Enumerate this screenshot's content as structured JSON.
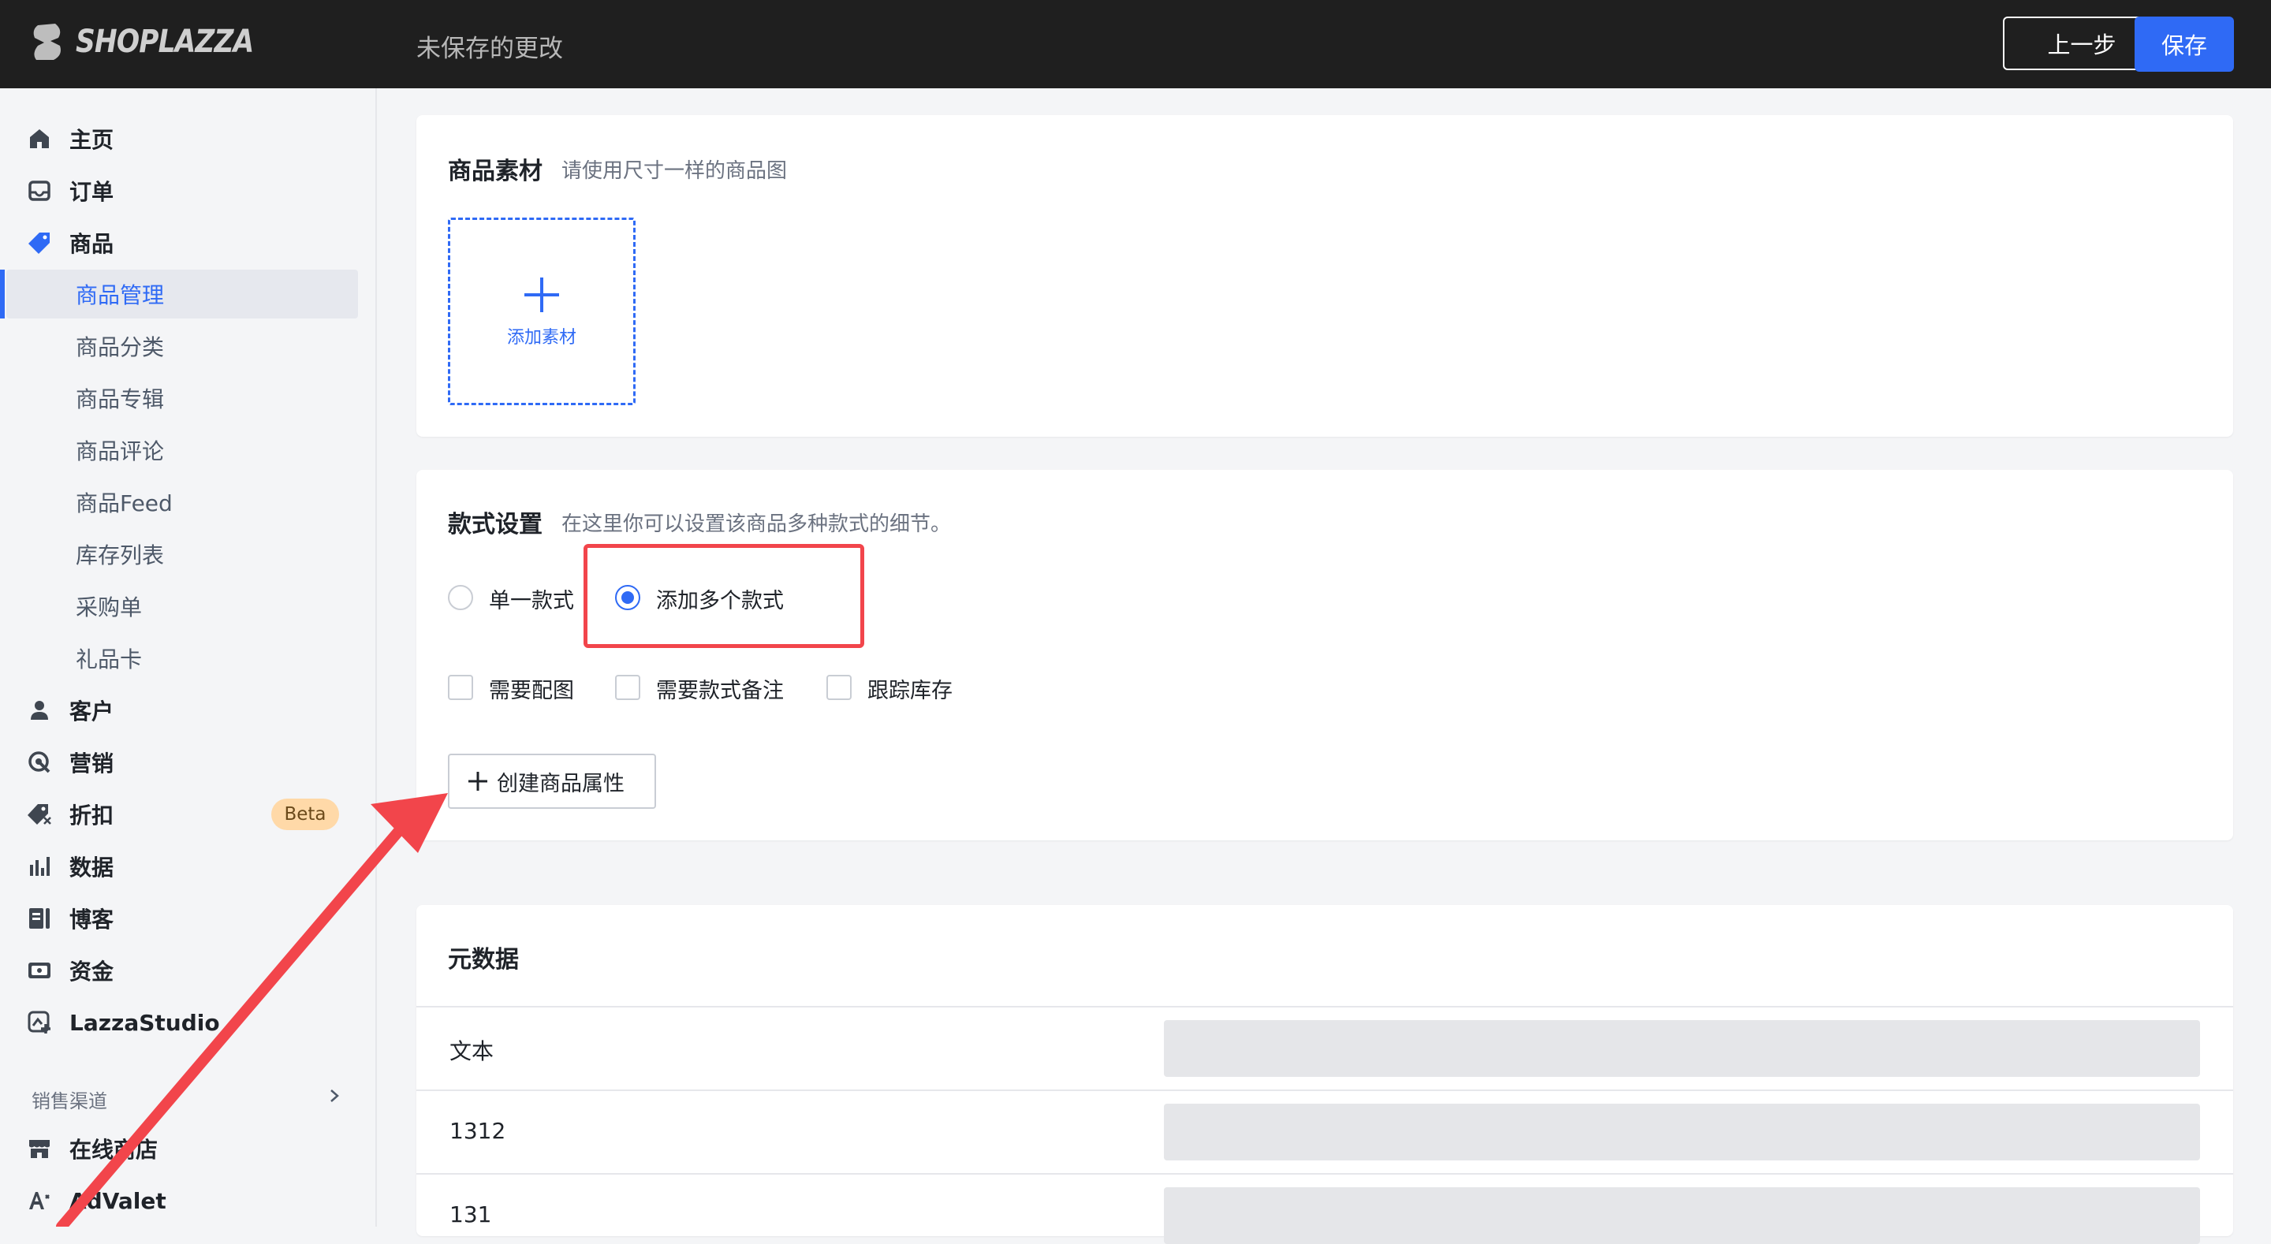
{
  "header": {
    "logo_text": "SHOPLAZZA",
    "unsaved_text": "未保存的更改",
    "back_label": "上一步",
    "save_label": "保存"
  },
  "sidebar": {
    "items": [
      {
        "label": "主页",
        "icon": "home-icon"
      },
      {
        "label": "订单",
        "icon": "inbox-icon"
      },
      {
        "label": "商品",
        "icon": "tag-icon"
      },
      {
        "label": "客户",
        "icon": "person-icon"
      },
      {
        "label": "营销",
        "icon": "target-icon"
      },
      {
        "label": "折扣",
        "icon": "discount-tag-icon"
      },
      {
        "label": "数据",
        "icon": "bar-chart-icon"
      },
      {
        "label": "博客",
        "icon": "blog-icon"
      },
      {
        "label": "资金",
        "icon": "wallet-icon"
      },
      {
        "label": "LazzaStudio",
        "icon": "studio-icon"
      }
    ],
    "product_sub": [
      {
        "label": "商品管理",
        "active": true
      },
      {
        "label": "商品分类"
      },
      {
        "label": "商品专辑"
      },
      {
        "label": "商品评论"
      },
      {
        "label": "商品Feed"
      },
      {
        "label": "库存列表"
      },
      {
        "label": "采购单"
      },
      {
        "label": "礼品卡"
      }
    ],
    "beta_badge": "Beta",
    "channels_label": "销售渠道",
    "channels": [
      {
        "label": "在线商店",
        "icon": "store-icon"
      },
      {
        "label": "AdValet",
        "icon": "ad-icon"
      }
    ]
  },
  "media_card": {
    "title": "商品素材",
    "hint": "请使用尺寸一样的商品图",
    "add_label": "添加素材"
  },
  "variant_card": {
    "title": "款式设置",
    "hint": "在这里你可以设置该商品多种款式的细节。",
    "radio_single": "单一款式",
    "radio_multi": "添加多个款式",
    "selected": "添加多个款式",
    "check_image": "需要配图",
    "check_note": "需要款式备注",
    "check_inventory": "跟踪库存",
    "create_attr_label": "创建商品属性"
  },
  "metadata_card": {
    "title": "元数据",
    "rows": [
      {
        "label": "文本"
      },
      {
        "label": "1312"
      },
      {
        "label": "131"
      }
    ]
  },
  "colors": {
    "accent": "#2f6af5",
    "annotation_red": "#f2454b",
    "topbar": "#1f1f1f",
    "beta_bg": "#ffd9a8"
  }
}
